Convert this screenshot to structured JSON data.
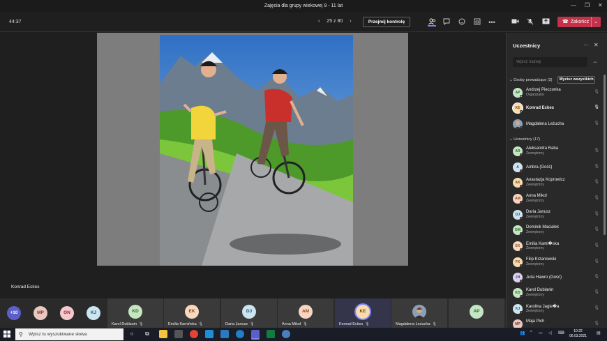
{
  "window": {
    "title": "Zajęcia dla grupy wiekowej 9 - 11 lat",
    "minimize": "—",
    "maximize": "❐",
    "close": "✕"
  },
  "toolbar": {
    "timer": "44:37",
    "pager": {
      "prev": "‹",
      "zoom": "25 z 80",
      "next": "›"
    },
    "take_control": "Przejmij kontrolę",
    "end_call": "Zakończ"
  },
  "stage": {
    "presenter": "Konrad Eckes"
  },
  "strip": {
    "overflow": "+10",
    "small_avatars": [
      {
        "initials": "MP",
        "color": "#e8c8c0"
      },
      {
        "initials": "ON",
        "color": "#f5c8cc"
      },
      {
        "initials": "KJ",
        "color": "#cbe6f0"
      }
    ],
    "tiles": [
      {
        "initials": "KD",
        "name": "Karol Dublanin",
        "color": "#c6e6c2"
      },
      {
        "initials": "EK",
        "name": "Emilia Kamińska",
        "color": "#f8d9c0"
      },
      {
        "initials": "DJ",
        "name": "Daria Janusz",
        "color": "#cde3ef"
      },
      {
        "initials": "AM",
        "name": "Anna Mikoł",
        "color": "#f8d5c2"
      },
      {
        "initials": "KE",
        "name": "Konrad Eckes",
        "color": "#f8dcb0"
      },
      {
        "initials": "",
        "name": "Magdalena Leżucha",
        "color": "#6b4a3a"
      },
      {
        "initials": "AP",
        "name": "",
        "color": "#c4e6c4"
      }
    ]
  },
  "panel": {
    "title": "Uczestnicy",
    "search_placeholder": "Wpisz nazwę",
    "presenters_label": "Osoby prowadzące (3)",
    "mute_all": "Wycisz wszystkich",
    "attendees_label": "Uczestnicy (17)",
    "presenters": [
      {
        "initials": "AP",
        "name": "Andrzej Pieczonka",
        "role": "Organizator",
        "color": "#c4e6c4",
        "status": "#d0d0d0"
      },
      {
        "initials": "KE",
        "name": "Konrad Eckes",
        "role": "",
        "color": "#f8dcb0",
        "status": "#92c353"
      },
      {
        "initials": "",
        "name": "Magdalena Leżucha",
        "role": "",
        "color": "#6b4a3a",
        "status": "#c4314b"
      }
    ],
    "attendees": [
      {
        "initials": "AR",
        "name": "Aleksandra Raba",
        "role": "Zewnętrzny",
        "color": "#c4e6c4",
        "status": "#c4314b"
      },
      {
        "initials": "A",
        "name": "Ambra (Gość)",
        "role": "",
        "color": "#cde3ef",
        "status": "#c4314b"
      },
      {
        "initials": "AK",
        "name": "Anastazja Koprowicz",
        "role": "Zewnętrzny",
        "color": "#f8dcb0",
        "status": "#c4314b"
      },
      {
        "initials": "AM",
        "name": "Anna Mikoł",
        "role": "Zewnętrzny",
        "color": "#f8d5c2",
        "status": "#c4314b"
      },
      {
        "initials": "DJ",
        "name": "Daria Janusz",
        "role": "Zewnętrzny",
        "color": "#cde3ef",
        "status": "#c4314b"
      },
      {
        "initials": "DM",
        "name": "Dominik Maciałek",
        "role": "Zewnętrzny",
        "color": "#c4e6c4",
        "status": "#c4314b"
      },
      {
        "initials": "EK",
        "name": "Emilia Kami�ska",
        "role": "Zewnętrzny",
        "color": "#f8d9c0",
        "status": "#c4314b"
      },
      {
        "initials": "FK",
        "name": "Filip Krzanowski",
        "role": "Zewnętrzny",
        "color": "#f8dcb0",
        "status": "#c4314b"
      },
      {
        "initials": "JH",
        "name": "Julia Hawro (Gość)",
        "role": "",
        "color": "#d9d2ee",
        "status": "#c4314b"
      },
      {
        "initials": "KD",
        "name": "Karol Dublanin",
        "role": "Zewnętrzny",
        "color": "#c6e6c2",
        "status": "#c4314b"
      },
      {
        "initials": "KJ",
        "name": "Karolina Jagie�a",
        "role": "Zewnętrzny",
        "color": "#cbe6f0",
        "status": "#c4314b"
      },
      {
        "initials": "MP",
        "name": "Maja Pich",
        "role": "",
        "color": "#e8c8c0",
        "status": "#c4314b"
      }
    ]
  },
  "taskbar": {
    "search_placeholder": "Wpisz tu wyszukiwane słowa",
    "time": "10:22",
    "date": "06.03.2021"
  }
}
